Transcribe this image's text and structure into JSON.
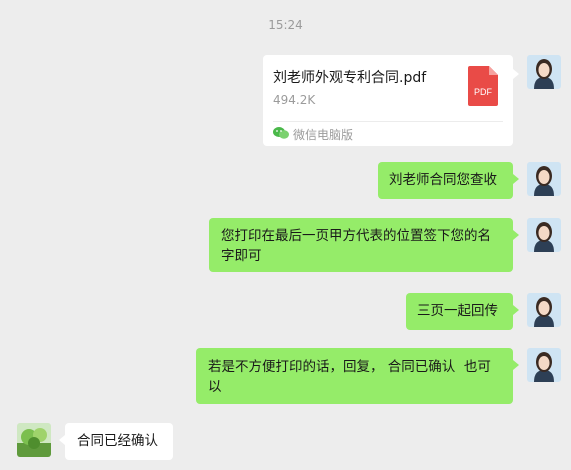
{
  "chat": {
    "timestamp": "15:24",
    "file_message": {
      "file_name": "刘老师外观专利合同.pdf",
      "file_size": "494.2K",
      "file_type_label": "PDF",
      "source_label": "微信电脑版",
      "source_icon": "wechat-icon"
    },
    "messages": [
      {
        "direction": "sent",
        "lines": [
          "刘老师合同您查收"
        ]
      },
      {
        "direction": "sent",
        "lines": [
          "您打印在最后一页甲方代表的位置签下您的名",
          "字即可"
        ]
      },
      {
        "direction": "sent",
        "lines": [
          "三页一起回传"
        ]
      },
      {
        "direction": "sent",
        "lines": [
          "若是不方便打印的话，回复， 合同已确认  也可",
          "以"
        ]
      },
      {
        "direction": "received",
        "lines": [
          "合同已经确认"
        ]
      }
    ]
  },
  "colors": {
    "background": "#ededed",
    "sent_bubble": "#95ec69",
    "received_bubble": "#ffffff",
    "pdf_icon": "#e94b47"
  }
}
